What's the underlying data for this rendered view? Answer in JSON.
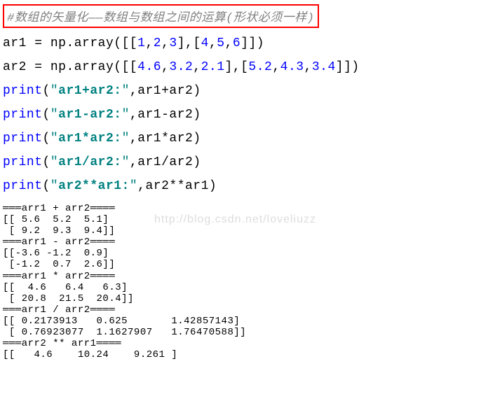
{
  "comment": "#数组的矢量化——数组与数组之间的运算(形状必须一样)",
  "line1": {
    "var": "ar1",
    "equals": "=",
    "np": "np.array",
    "open": "([[",
    "n1": "1",
    "c1": ",",
    "n2": "2",
    "c2": ",",
    "n3": "3",
    "mid": "],[",
    "n4": "4",
    "c3": ",",
    "n5": "5",
    "c4": ",",
    "n6": "6",
    "close": "]])"
  },
  "line2": {
    "var": "ar2",
    "equals": "=",
    "np": "np.array",
    "open": "([[",
    "n1": "4.6",
    "c1": ",",
    "n2": "3.2",
    "c2": ",",
    "n3": "2.1",
    "mid": "],[",
    "n4": "5.2",
    "c3": ",",
    "n5": "4.3",
    "c4": ",",
    "n6": "3.4",
    "close": "]])"
  },
  "print1": {
    "kw": "print",
    "open": "(",
    "q1": "\"",
    "str": "ar1+ar2:",
    "q2": "\"",
    "c": ",",
    "expr": "ar1+ar2",
    "close": ")"
  },
  "print2": {
    "kw": "print",
    "open": "(",
    "q1": "\"",
    "str": "ar1-ar2:",
    "q2": "\"",
    "c": ",",
    "expr": "ar1-ar2",
    "close": ")"
  },
  "print3": {
    "kw": "print",
    "open": "(",
    "q1": "\"",
    "str": "ar1*ar2:",
    "q2": "\"",
    "c": ",",
    "expr": "ar1*ar2",
    "close": ")"
  },
  "print4": {
    "kw": "print",
    "open": "(",
    "q1": "\"",
    "str": "ar1/ar2:",
    "q2": "\"",
    "c": ",",
    "expr": "ar1/ar2",
    "close": ")"
  },
  "print5": {
    "kw": "print",
    "open": "(",
    "q1": "\"",
    "str": "ar2**ar1:",
    "q2": "\"",
    "c": ",",
    "expr": "ar2**ar1",
    "close": ")"
  },
  "watermark": "http://blog.csdn.net/loveliuzz",
  "output": "═══arr1 + arr2════\n[[ 5.6  5.2  5.1]\n [ 9.2  9.3  9.4]]\n═══arr1 - arr2════\n[[-3.6 -1.2  0.9]\n [-1.2  0.7  2.6]]\n═══arr1 * arr2════\n[[  4.6   6.4   6.3]\n [ 20.8  21.5  20.4]]\n═══arr1 / arr2════\n[[ 0.2173913   0.625       1.42857143]\n [ 0.76923077  1.1627907   1.76470588]]\n═══arr2 ** arr1════\n[[   4.6    10.24    9.261 ]"
}
